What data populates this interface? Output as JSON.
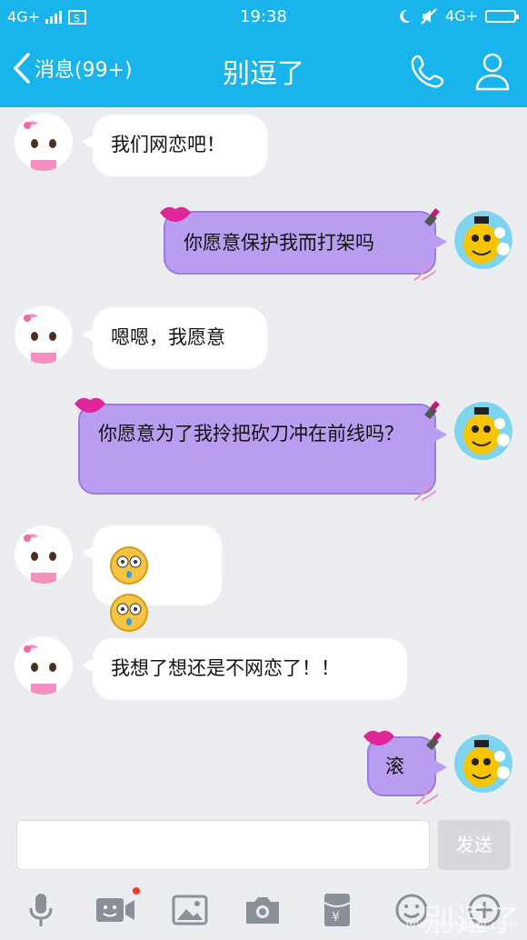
{
  "status": {
    "network_left": "4G+",
    "time": "19:38",
    "network_right": "4G+"
  },
  "header": {
    "back_label": "消息(99+)",
    "title": "别逗了"
  },
  "messages": [
    {
      "side": "left",
      "text": "我们网恋吧！"
    },
    {
      "side": "right",
      "text": "你愿意保护我而打架吗"
    },
    {
      "side": "left",
      "text": "嗯嗯，我愿意"
    },
    {
      "side": "right",
      "text": "你愿意为了我拎把砍刀冲在前线吗？"
    },
    {
      "side": "left",
      "text": "",
      "emojis": [
        "shocked-face",
        "shocked-face"
      ]
    },
    {
      "side": "left",
      "text": "我想了想还是不网恋了！！"
    },
    {
      "side": "right",
      "text": "滚"
    }
  ],
  "composer": {
    "send_label": "发送"
  },
  "toolbar": {
    "icons": [
      "microphone-icon",
      "video-icon",
      "image-icon",
      "camera-icon",
      "red-packet-icon",
      "emoji-icon",
      "plus-icon"
    ]
  },
  "watermark": {
    "text": "别逗了",
    "url": "www.biedoul.com"
  },
  "colors": {
    "header_bg": "#19b4ec",
    "bubble_right_bg": "#b99df0",
    "chat_bg": "#ebedf0"
  }
}
